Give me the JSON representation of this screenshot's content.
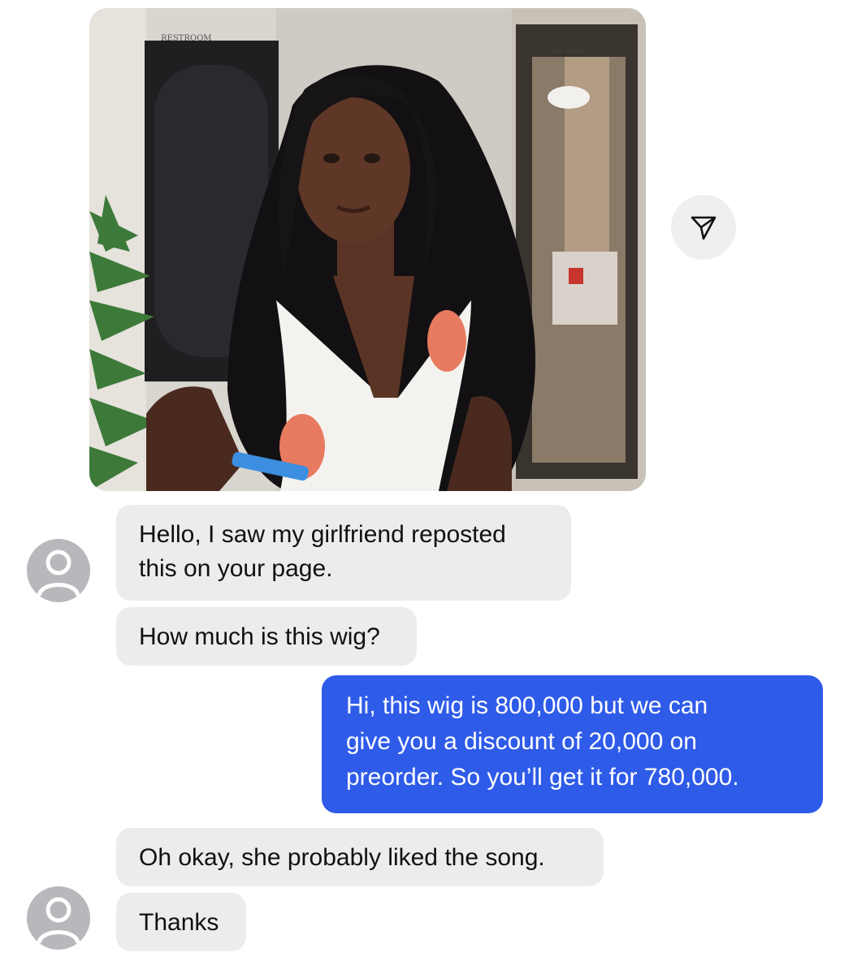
{
  "shared_post": {
    "image_alt": "Woman wearing long black wavy wig and a white floral wrap top",
    "sign_restroom": "RESTROOM",
    "sign_office": "CEO OFFICE"
  },
  "share_button": {
    "icon": "send-icon"
  },
  "messages": [
    {
      "direction": "incoming",
      "text": "Hello, I saw my girlfriend reposted\nthis on your page."
    },
    {
      "direction": "incoming",
      "text": "How much is this wig?"
    },
    {
      "direction": "outgoing",
      "text": "Hi, this wig is 800,000 but we can\ngive you a discount of 20,000 on\npreorder. So you’ll get it for 780,000."
    },
    {
      "direction": "incoming",
      "text": "Oh okay, she probably liked the song."
    },
    {
      "direction": "incoming",
      "text": "Thanks"
    }
  ],
  "colors": {
    "outgoing_bubble": "#2f5be9",
    "incoming_bubble": "#ececee",
    "avatar_placeholder": "#b7b7bc"
  }
}
